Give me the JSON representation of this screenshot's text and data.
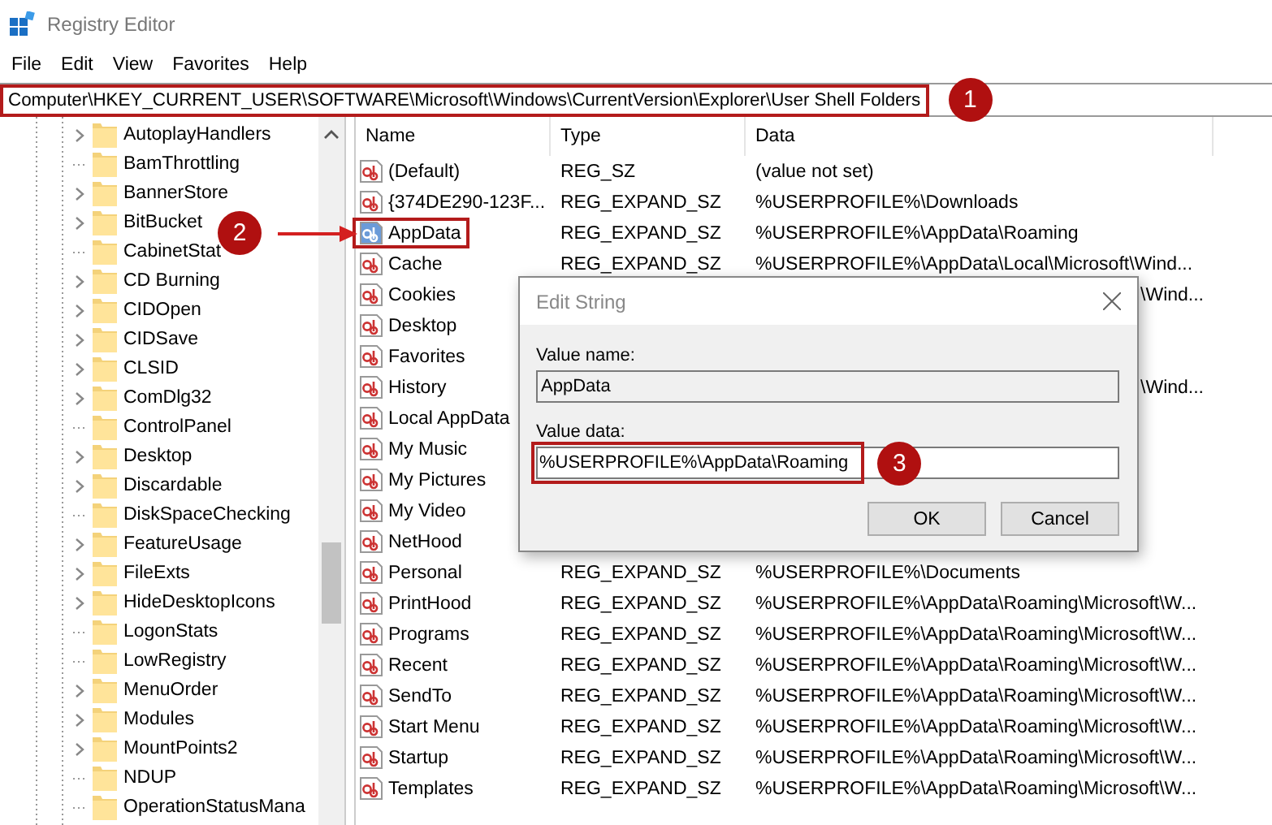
{
  "window": {
    "title": "Registry Editor"
  },
  "menu": [
    "File",
    "Edit",
    "View",
    "Favorites",
    "Help"
  ],
  "address": {
    "path": "Computer\\HKEY_CURRENT_USER\\SOFTWARE\\Microsoft\\Windows\\CurrentVersion\\Explorer\\User Shell Folders",
    "highlighted": true,
    "badge": "1"
  },
  "tree": [
    {
      "label": "AutoplayHandlers",
      "expandable": true
    },
    {
      "label": "BamThrottling",
      "expandable": false
    },
    {
      "label": "BannerStore",
      "expandable": true
    },
    {
      "label": "BitBucket",
      "expandable": true
    },
    {
      "label": "CabinetStat",
      "expandable": false
    },
    {
      "label": "CD Burning",
      "expandable": true
    },
    {
      "label": "CIDOpen",
      "expandable": true
    },
    {
      "label": "CIDSave",
      "expandable": true
    },
    {
      "label": "CLSID",
      "expandable": true
    },
    {
      "label": "ComDlg32",
      "expandable": true
    },
    {
      "label": "ControlPanel",
      "expandable": false
    },
    {
      "label": "Desktop",
      "expandable": true
    },
    {
      "label": "Discardable",
      "expandable": true
    },
    {
      "label": "DiskSpaceChecking",
      "expandable": false
    },
    {
      "label": "FeatureUsage",
      "expandable": true
    },
    {
      "label": "FileExts",
      "expandable": true
    },
    {
      "label": "HideDesktopIcons",
      "expandable": true
    },
    {
      "label": "LogonStats",
      "expandable": false
    },
    {
      "label": "LowRegistry",
      "expandable": false
    },
    {
      "label": "MenuOrder",
      "expandable": true
    },
    {
      "label": "Modules",
      "expandable": true
    },
    {
      "label": "MountPoints2",
      "expandable": true
    },
    {
      "label": "NDUP",
      "expandable": false
    },
    {
      "label": "OperationStatusMana",
      "expandable": false
    }
  ],
  "table": {
    "columns": [
      "Name",
      "Type",
      "Data"
    ],
    "rows": [
      {
        "name": "(Default)",
        "type": "REG_SZ",
        "data": "(value not set)",
        "selected": false
      },
      {
        "name": "{374DE290-123F...",
        "type": "REG_EXPAND_SZ",
        "data": "%USERPROFILE%\\Downloads",
        "selected": false
      },
      {
        "name": "AppData",
        "type": "REG_EXPAND_SZ",
        "data": "%USERPROFILE%\\AppData\\Roaming",
        "selected": true,
        "highlighted": true,
        "badge": "2"
      },
      {
        "name": "Cache",
        "type": "REG_EXPAND_SZ",
        "data": "%USERPROFILE%\\AppData\\Local\\Microsoft\\Wind...",
        "selected": false
      },
      {
        "name": "Cookies",
        "data": "\\Wind...",
        "data_covered": true,
        "selected": false
      },
      {
        "name": "Desktop",
        "selected": false
      },
      {
        "name": "Favorites",
        "selected": false
      },
      {
        "name": "History",
        "data": "\\Wind...",
        "data_covered": true,
        "selected": false
      },
      {
        "name": "Local AppData",
        "selected": false
      },
      {
        "name": "My Music",
        "selected": false
      },
      {
        "name": "My Pictures",
        "selected": false
      },
      {
        "name": "My Video",
        "selected": false
      },
      {
        "name": "NetHood",
        "selected": false
      },
      {
        "name": "Personal",
        "type": "REG_EXPAND_SZ",
        "data": "%USERPROFILE%\\Documents",
        "selected": false
      },
      {
        "name": "PrintHood",
        "type": "REG_EXPAND_SZ",
        "data": "%USERPROFILE%\\AppData\\Roaming\\Microsoft\\W...",
        "selected": false
      },
      {
        "name": "Programs",
        "type": "REG_EXPAND_SZ",
        "data": "%USERPROFILE%\\AppData\\Roaming\\Microsoft\\W...",
        "selected": false
      },
      {
        "name": "Recent",
        "type": "REG_EXPAND_SZ",
        "data": "%USERPROFILE%\\AppData\\Roaming\\Microsoft\\W...",
        "selected": false
      },
      {
        "name": "SendTo",
        "type": "REG_EXPAND_SZ",
        "data": "%USERPROFILE%\\AppData\\Roaming\\Microsoft\\W...",
        "selected": false
      },
      {
        "name": "Start Menu",
        "type": "REG_EXPAND_SZ",
        "data": "%USERPROFILE%\\AppData\\Roaming\\Microsoft\\W...",
        "selected": false
      },
      {
        "name": "Startup",
        "type": "REG_EXPAND_SZ",
        "data": "%USERPROFILE%\\AppData\\Roaming\\Microsoft\\W...",
        "selected": false
      },
      {
        "name": "Templates",
        "type": "REG_EXPAND_SZ",
        "data": "%USERPROFILE%\\AppData\\Roaming\\Microsoft\\W...",
        "selected": false
      }
    ]
  },
  "dialog": {
    "title": "Edit String",
    "value_name_label": "Value name:",
    "value_name": "AppData",
    "value_data_label": "Value data:",
    "value_data": "%USERPROFILE%\\AppData\\Roaming",
    "value_data_highlighted": true,
    "value_data_badge": "3",
    "buttons": [
      "OK",
      "Cancel"
    ]
  }
}
